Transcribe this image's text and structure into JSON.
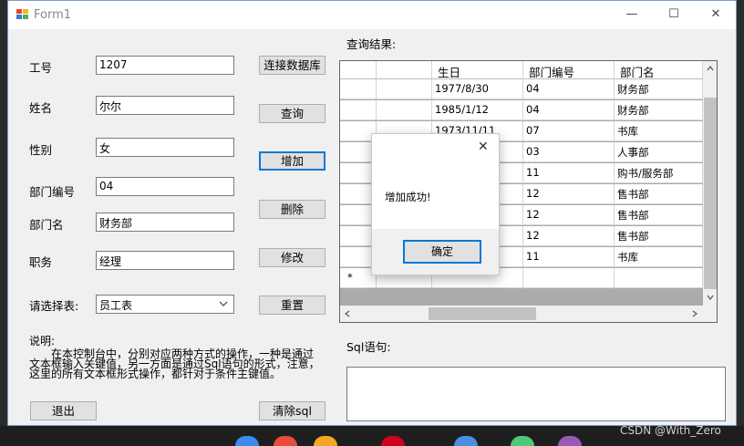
{
  "window": {
    "title": "Form1",
    "minimize_glyph": "—",
    "maximize_glyph": "☐",
    "close_glyph": "✕"
  },
  "form": {
    "emp_id_label": "工号",
    "emp_id_value": "1207",
    "name_label": "姓名",
    "name_value": "尔尔",
    "gender_label": "性别",
    "gender_value": "女",
    "dept_no_label": "部门编号",
    "dept_no_value": "04",
    "dept_name_label": "部门名",
    "dept_name_value": "财务部",
    "position_label": "职务",
    "position_value": "经理",
    "table_select_label": "请选择表:",
    "table_select_value": "员工表",
    "note_title": "说明:",
    "note_line1": "　　在本控制台中，分别对应两种方式的操作，一种是通过",
    "note_line2": "文本框输入关键值，另一方面是通过Sql语句的形式，注意，",
    "note_line3": "这里的所有文本框形式操作，都针对于条件主键值。"
  },
  "buttons": {
    "connect": "连接数据库",
    "query": "查询",
    "add": "增加",
    "delete": "删除",
    "modify": "修改",
    "reset": "重置",
    "exit": "退出",
    "clear_sql": "清除sql"
  },
  "results": {
    "label": "查询结果:",
    "columns": [
      "",
      "生日",
      "部门编号",
      "部门名"
    ],
    "rows": [
      [
        "",
        "1977/8/30",
        "04",
        "财务部"
      ],
      [
        "",
        "1985/1/12",
        "04",
        "财务部"
      ],
      [
        "",
        "1973/11/11",
        "07",
        "书库"
      ],
      [
        "",
        "",
        "03",
        "人事部"
      ],
      [
        "",
        "",
        "11",
        "购书/服务部"
      ],
      [
        "",
        "",
        "12",
        "售书部"
      ],
      [
        "",
        "",
        "12",
        "售书部"
      ],
      [
        "",
        "",
        "12",
        "售书部"
      ],
      [
        "",
        "",
        "11",
        "书库"
      ]
    ],
    "new_row_marker": "*"
  },
  "sql": {
    "label": "Sql语句:",
    "value": ""
  },
  "dialog": {
    "message": "增加成功!",
    "ok_button": "确定",
    "close_glyph": "✕"
  },
  "watermark": "CSDN @With_Zero",
  "colors": {
    "accent": "#0078d7",
    "window_bg": "#f0f0f0",
    "grid_bg": "#ababab"
  }
}
